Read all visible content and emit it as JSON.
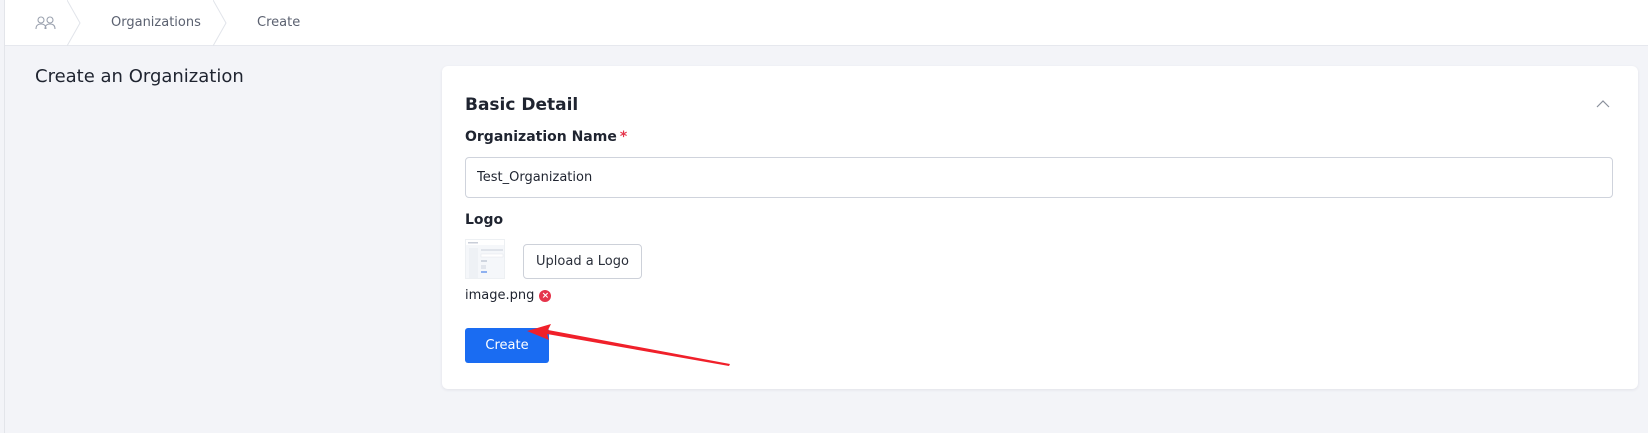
{
  "breadcrumb": {
    "home_icon": "users-icon",
    "items": [
      "Organizations",
      "Create"
    ]
  },
  "page": {
    "title": "Create an Organization"
  },
  "card": {
    "title": "Basic Detail",
    "collapse_icon": "chevron-up-icon",
    "org_name_label": "Organization Name",
    "required_mark": "*",
    "org_name_value": "Test_Organization",
    "logo_label": "Logo",
    "upload_button": "Upload a Logo",
    "file_name": "image.png",
    "remove_icon": "close-circle-icon",
    "create_button": "Create"
  },
  "colors": {
    "primary": "#1a6cf2",
    "required": "#e5344b",
    "annotation_arrow": "#f0202a"
  }
}
